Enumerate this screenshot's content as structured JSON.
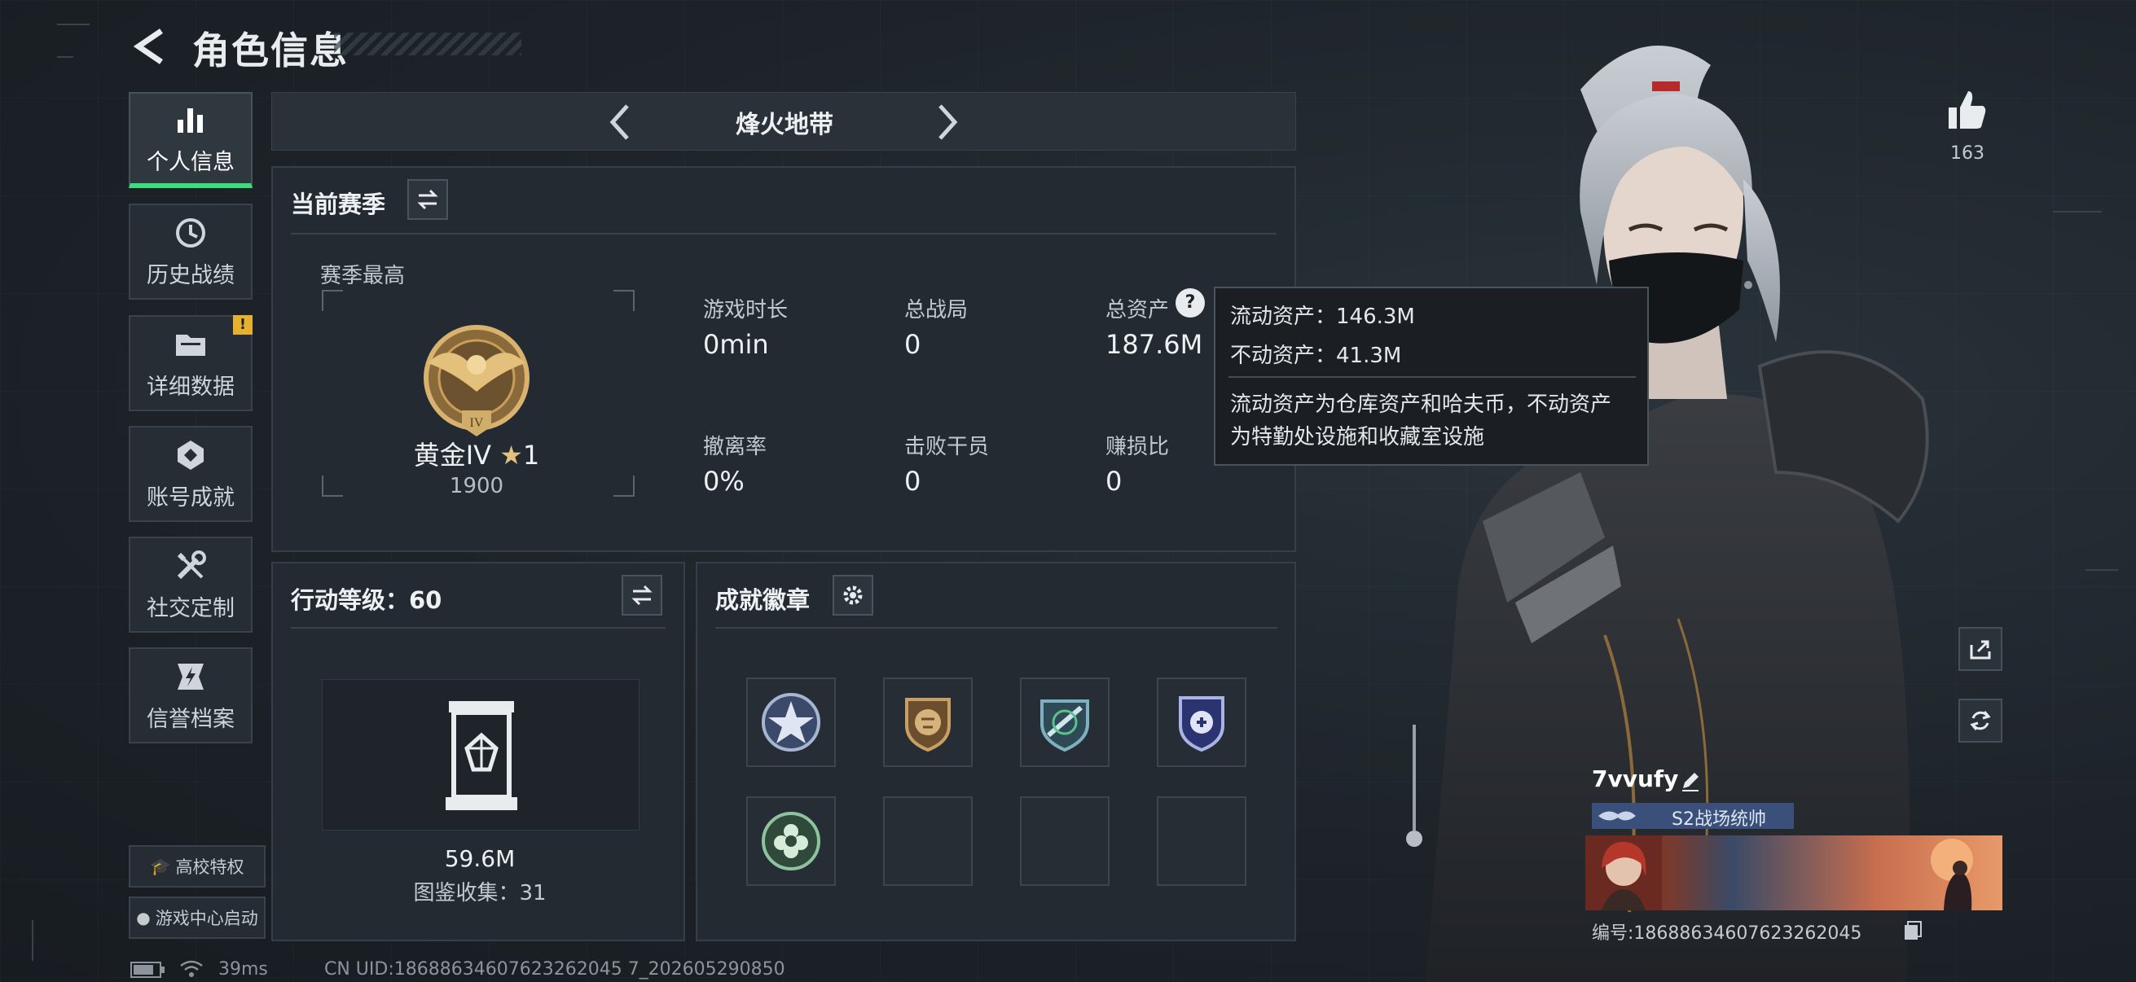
{
  "header": {
    "title": "角色信息"
  },
  "sidebar": {
    "items": [
      {
        "label": "个人信息",
        "icon": "bar-chart-icon",
        "active": true
      },
      {
        "label": "历史战绩",
        "icon": "history-icon"
      },
      {
        "label": "详细数据",
        "icon": "folder-icon",
        "badge": "!"
      },
      {
        "label": "账号成就",
        "icon": "achievement-icon"
      },
      {
        "label": "社交定制",
        "icon": "tools-icon"
      },
      {
        "label": "信誉档案",
        "icon": "credit-icon"
      }
    ],
    "campus_label": "高校特权",
    "game_center_label": "游戏中心启动"
  },
  "mode_bar": {
    "title": "烽火地带"
  },
  "season": {
    "heading": "当前赛季",
    "best_label": "赛季最高",
    "rank_name": "黄金IV",
    "rank_stars": "1",
    "rank_score": "1900",
    "rank_emblem_numeral": "IV",
    "stats": [
      {
        "label": "游戏时长",
        "value": "0min"
      },
      {
        "label": "总战局",
        "value": "0"
      },
      {
        "label": "总资产",
        "value": "187.6M"
      },
      {
        "label": "撤离率",
        "value": "0%"
      },
      {
        "label": "击败干员",
        "value": "0"
      },
      {
        "label": "赚损比",
        "value": "0"
      }
    ]
  },
  "tooltip": {
    "liquid": "流动资产：146.3M",
    "fixed": "不动资产：41.3M",
    "desc_line1": "流动资产为仓库资产和哈夫币，不动资产",
    "desc_line2": "为特勤处设施和收藏室设施"
  },
  "action_level": {
    "heading": "行动等级：60",
    "value": "59.6M",
    "collection": "图鉴收集：31"
  },
  "achievements": {
    "heading": "成就徽章",
    "badges": [
      "star-badge",
      "lion-badge",
      "rifle-badge",
      "shield-badge",
      "flower-badge",
      "empty",
      "empty",
      "empty"
    ]
  },
  "profile": {
    "likes": "163",
    "name": "7vvufy",
    "title": "S2战场统帅",
    "uid": "编号:18688634607623262045"
  },
  "footer": {
    "ping": "39ms",
    "cn_uid": "CN UID:18688634607623262045 7_202605290850"
  },
  "colors": {
    "accent_green": "#39e07a",
    "warning_yellow": "#e6b12e",
    "panel_bg": "#232a31"
  }
}
